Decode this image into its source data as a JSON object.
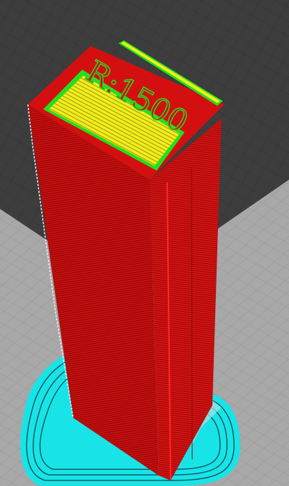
{
  "viewport": {
    "view": "layer-preview",
    "colors": {
      "background": "#3c3c3c",
      "build_plate": "#a9a9a9",
      "grid": "#8e8e8e",
      "outer_wall": "#d40f0f",
      "inner_wall": "#22e01e",
      "top_bottom_infill": "#f2ee1c",
      "skirt_brim": "#18e4e8",
      "support": "#9fe3e3"
    }
  },
  "model": {
    "embossed_text": "R:1500"
  }
}
